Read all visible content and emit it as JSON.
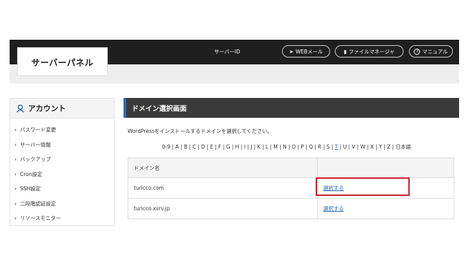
{
  "header": {
    "logo": "サーバーパネル",
    "server_id": "サーバーID",
    "buttons": [
      {
        "label": "WEBメール",
        "icon": "paper-plane-icon"
      },
      {
        "label": "ファイルマネージャ",
        "icon": "folder-icon"
      },
      {
        "label": "マニュアル",
        "icon": "question-circle-icon"
      }
    ]
  },
  "sidebar": {
    "title": "アカウント",
    "icon": "person-icon",
    "items": [
      {
        "label": "パスワード変更"
      },
      {
        "label": "サーバー情報"
      },
      {
        "label": "バックアップ"
      },
      {
        "label": "Cron設定"
      },
      {
        "label": "SSH設定"
      },
      {
        "label": "二段階認証設定"
      },
      {
        "label": "リソースモニター"
      }
    ]
  },
  "main": {
    "title": "ドメイン選択画面",
    "description": "WordPressをインストールするドメインを選択してください。",
    "alpha_before": "0-9 | A | B | C | D | E | F | G | H | I | J | K | L | M | N | O | P | Q | R | S | ",
    "alpha_active": "T",
    "alpha_after": " | U | V | W | X | Y | Z | 日本語",
    "table": {
      "header": {
        "col1": "ドメイン名",
        "col2": ""
      },
      "rows": [
        {
          "domain": "turicco.com",
          "action": "選択する"
        },
        {
          "domain": "turicco.xsrv.jp",
          "action": "選択する"
        }
      ]
    }
  },
  "colors": {
    "header_bg": "#1f1f1f",
    "accent": "#2a6bb5",
    "highlight_box": "#c8202b"
  }
}
